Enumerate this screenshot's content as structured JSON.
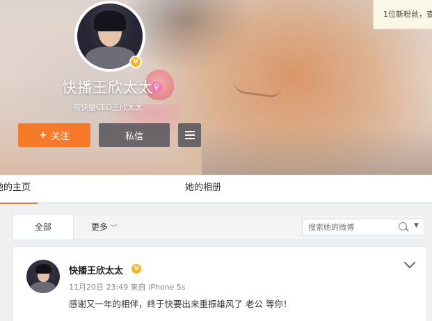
{
  "profile": {
    "name": "快播王欣太太",
    "description": "前快播CEO王欣太太",
    "gender_icon": "female-icon",
    "verified_icon": "V"
  },
  "actions": {
    "follow_label": "关注",
    "follow_prefix": "+",
    "message_label": "私信",
    "menu_icon": "menu-icon"
  },
  "notice": {
    "text": "1位新粉丝，查"
  },
  "tabs": [
    {
      "label": "她的主页",
      "active": true
    },
    {
      "label": "她的相册",
      "active": false
    }
  ],
  "filter": {
    "all_label": "全部",
    "more_label": "更多",
    "search_placeholder": "搜索她的微博"
  },
  "post": {
    "author": "快播王欣太太",
    "verified_icon": "V",
    "meta": "11月20日 23:49 来自 iPhone 5s",
    "text": "感谢又一年的相伴，终于快要出来重振雄风了 老公 等你！"
  },
  "colors": {
    "accent": "#f77a2b",
    "verified": "#f3b52b",
    "gender": "#f07ab4"
  }
}
